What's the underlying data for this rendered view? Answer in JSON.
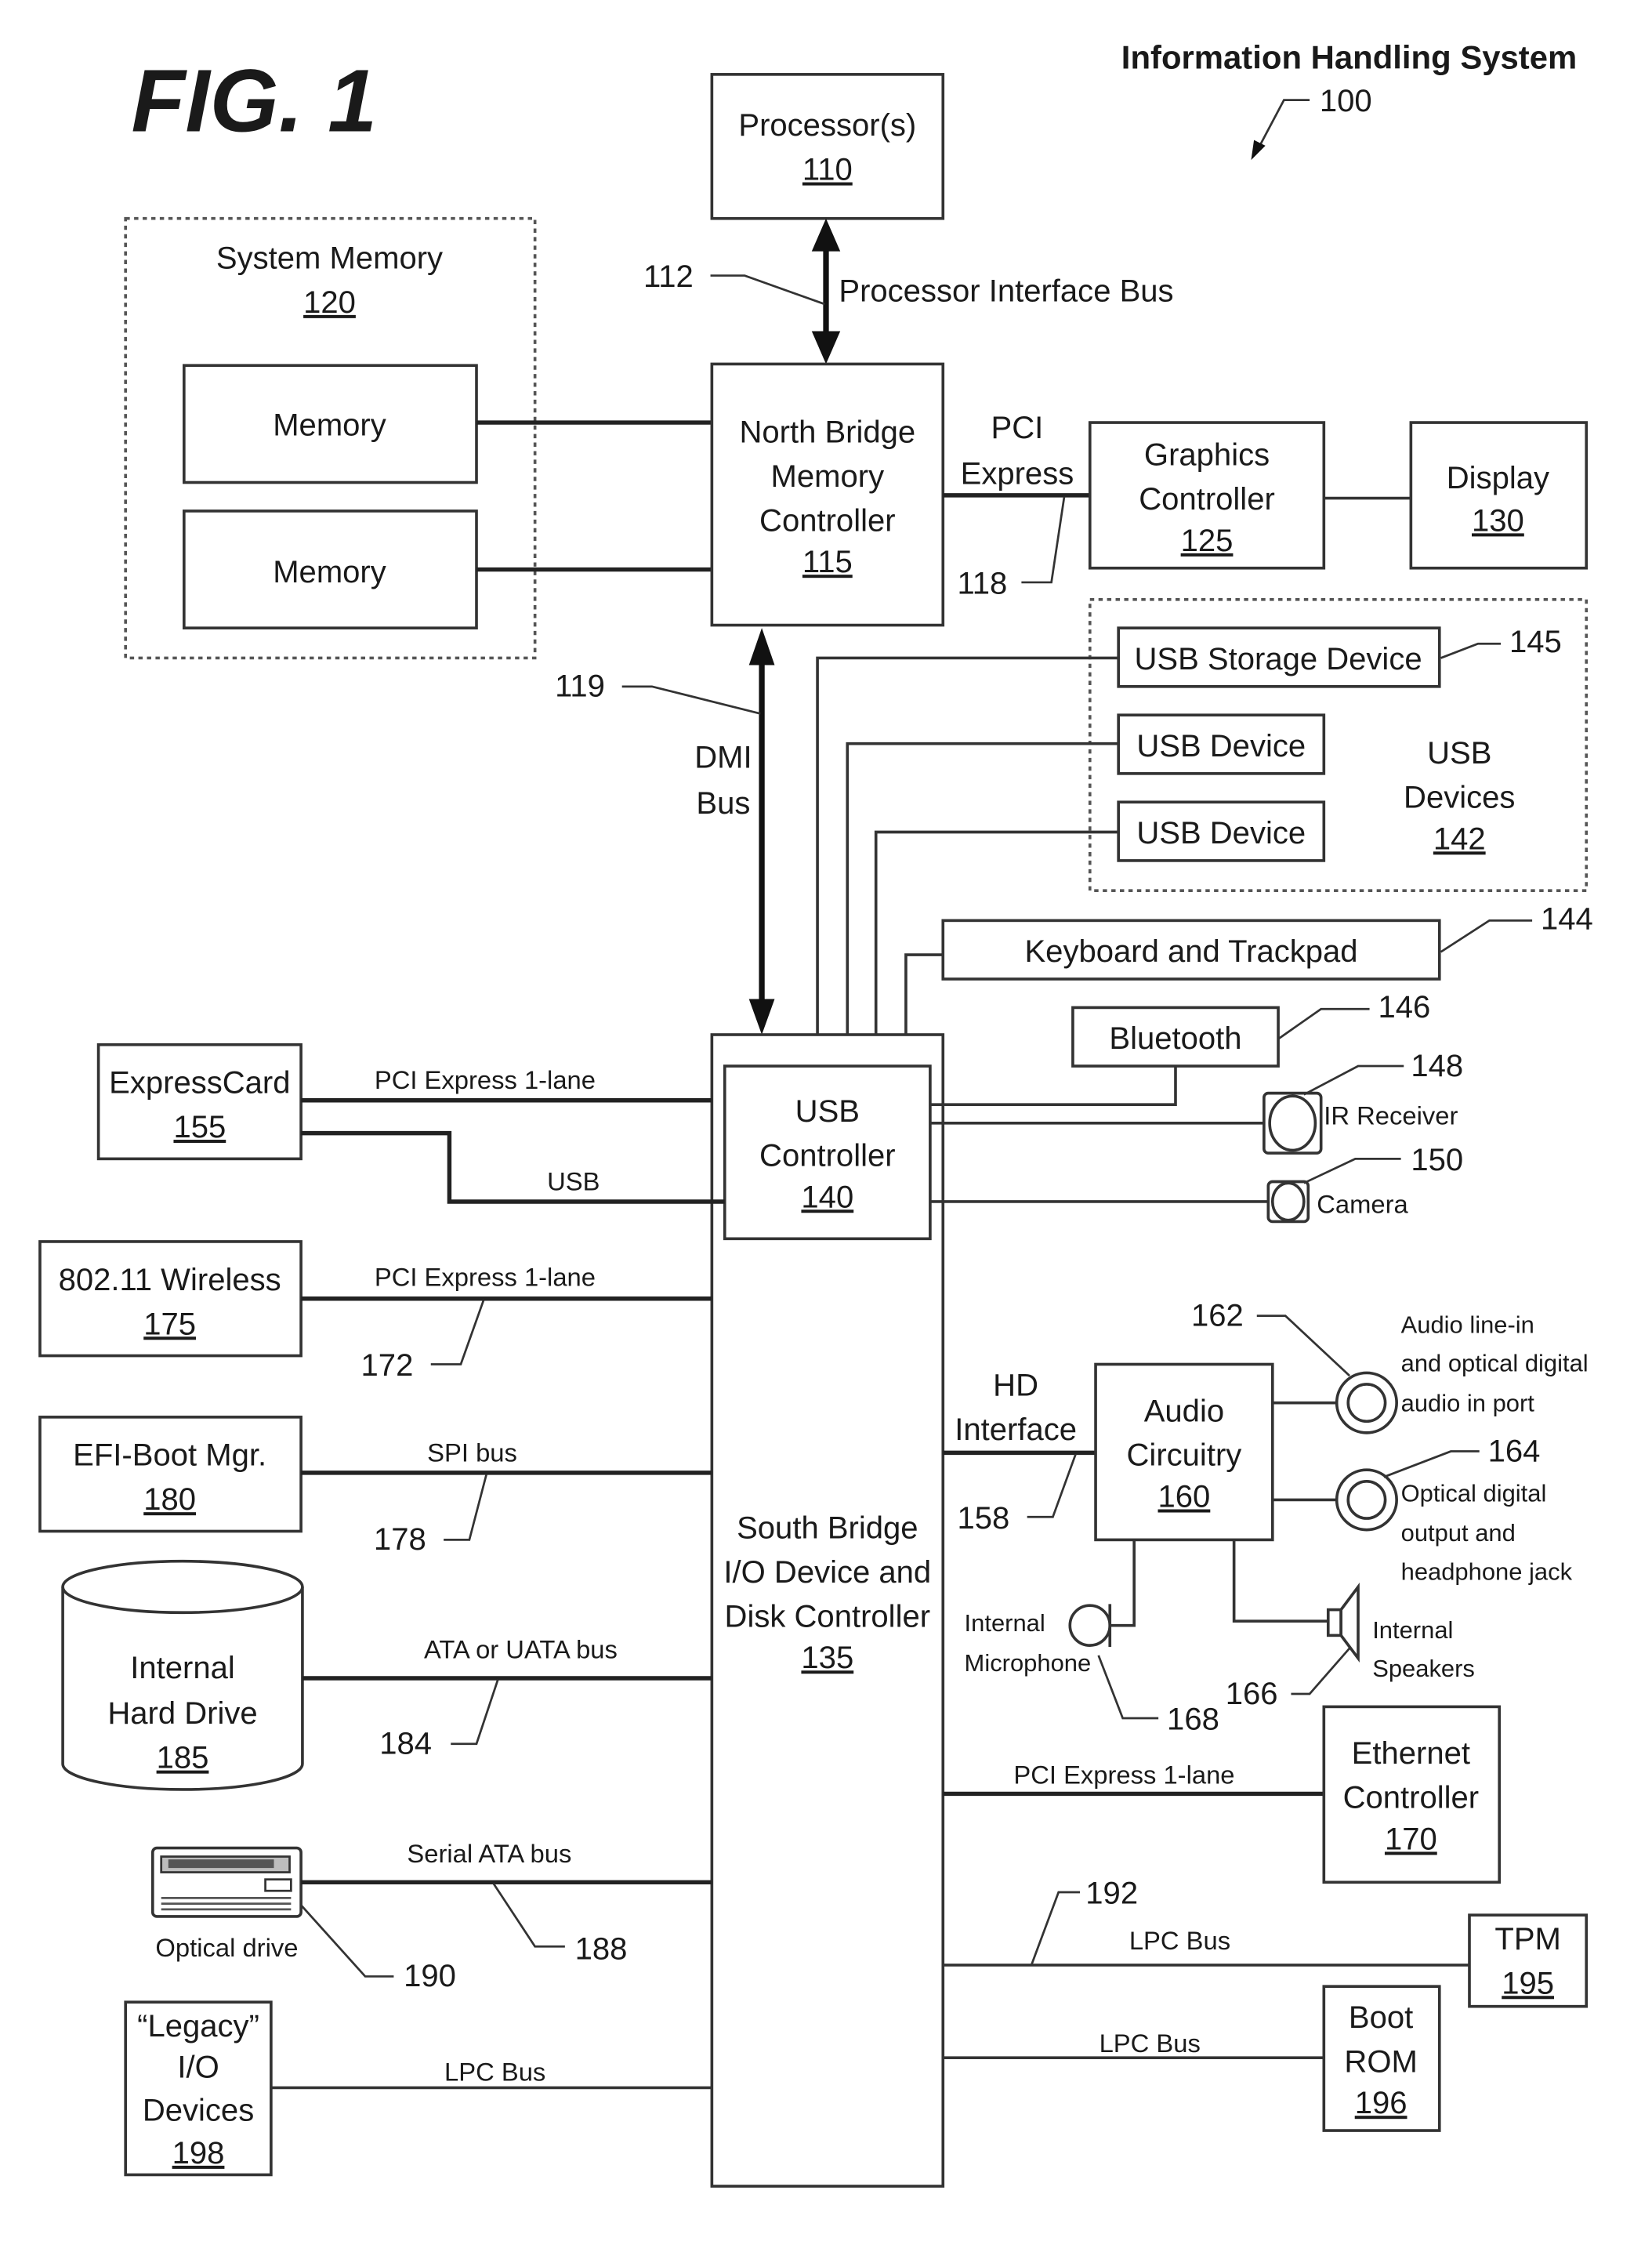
{
  "figure": {
    "title": "FIG. 1",
    "system_title": "Information Handling System",
    "system_ref": "100"
  },
  "components": {
    "processor": {
      "label": "Processor(s)",
      "ref": "110"
    },
    "system_memory": {
      "label": "System Memory",
      "ref": "120"
    },
    "memory_1": {
      "label": "Memory"
    },
    "memory_2": {
      "label": "Memory"
    },
    "north_bridge": {
      "lines": [
        "North Bridge",
        "Memory",
        "Controller"
      ],
      "ref": "115"
    },
    "graphics_controller": {
      "lines": [
        "Graphics",
        "Controller"
      ],
      "ref": "125"
    },
    "display": {
      "label": "Display",
      "ref": "130"
    },
    "usb_devices": {
      "lines": [
        "USB",
        "Devices"
      ],
      "ref": "142"
    },
    "usb_storage_device": {
      "label": "USB Storage Device",
      "ref": "145"
    },
    "usb_device_1": {
      "label": "USB Device"
    },
    "usb_device_2": {
      "label": "USB Device"
    },
    "keyboard_trackpad": {
      "label": "Keyboard and Trackpad",
      "ref": "144"
    },
    "bluetooth": {
      "label": "Bluetooth",
      "ref": "146"
    },
    "ir_receiver": {
      "label": "IR Receiver",
      "ref": "148"
    },
    "camera": {
      "label": "Camera",
      "ref": "150"
    },
    "usb_controller": {
      "lines": [
        "USB",
        "Controller"
      ],
      "ref": "140"
    },
    "south_bridge": {
      "lines": [
        "South Bridge",
        "I/O Device and",
        "Disk Controller"
      ],
      "ref": "135"
    },
    "expresscard": {
      "label": "ExpressCard",
      "ref": "155"
    },
    "wireless": {
      "label": "802.11 Wireless",
      "ref": "175"
    },
    "efi_boot": {
      "label": "EFI-Boot Mgr.",
      "ref": "180"
    },
    "hard_drive": {
      "lines": [
        "Internal",
        "Hard Drive"
      ],
      "ref": "185"
    },
    "optical_drive": {
      "label": "Optical drive",
      "ref": "190"
    },
    "legacy_io": {
      "lines": [
        "“Legacy”",
        "I/O",
        "Devices"
      ],
      "ref": "198"
    },
    "audio_circuitry": {
      "lines": [
        "Audio",
        "Circuitry"
      ],
      "ref": "160"
    },
    "audio_line_in": {
      "lines": [
        "Audio line-in",
        "and optical digital",
        "audio in port"
      ],
      "ref": "162"
    },
    "optical_out": {
      "lines": [
        "Optical digital",
        "output and",
        "headphone jack"
      ],
      "ref": "164"
    },
    "speakers": {
      "lines": [
        "Internal",
        "Speakers"
      ],
      "ref": "166"
    },
    "microphone": {
      "lines": [
        "Internal",
        "Microphone"
      ],
      "ref": "168"
    },
    "ethernet": {
      "lines": [
        "Ethernet",
        "Controller"
      ],
      "ref": "170"
    },
    "tpm": {
      "label": "TPM",
      "ref": "195"
    },
    "boot_rom": {
      "lines": [
        "Boot",
        "ROM"
      ],
      "ref": "196"
    }
  },
  "buses": {
    "processor_interface": {
      "label": "Processor Interface Bus",
      "ref": "112"
    },
    "pci_express": {
      "lines": [
        "PCI",
        "Express"
      ],
      "ref": "118"
    },
    "dmi": {
      "lines": [
        "DMI",
        "Bus"
      ],
      "ref": "119"
    },
    "expresscard_pcie": {
      "label": "PCI Express 1-lane"
    },
    "expresscard_usb": {
      "label": "USB"
    },
    "wireless_pcie": {
      "label": "PCI Express 1-lane",
      "ref": "172"
    },
    "spi": {
      "label": "SPI bus",
      "ref": "178"
    },
    "ata": {
      "label": "ATA or UATA bus",
      "ref": "184"
    },
    "serial_ata": {
      "label": "Serial ATA bus",
      "ref": "188"
    },
    "legacy_lpc": {
      "label": "LPC Bus"
    },
    "hd_interface": {
      "lines": [
        "HD",
        "Interface"
      ],
      "ref": "158"
    },
    "ethernet_pcie": {
      "label": "PCI Express 1-lane"
    },
    "tpm_lpc": {
      "label": "LPC Bus",
      "ref": "192"
    },
    "bootrom_lpc": {
      "label": "LPC Bus"
    }
  }
}
